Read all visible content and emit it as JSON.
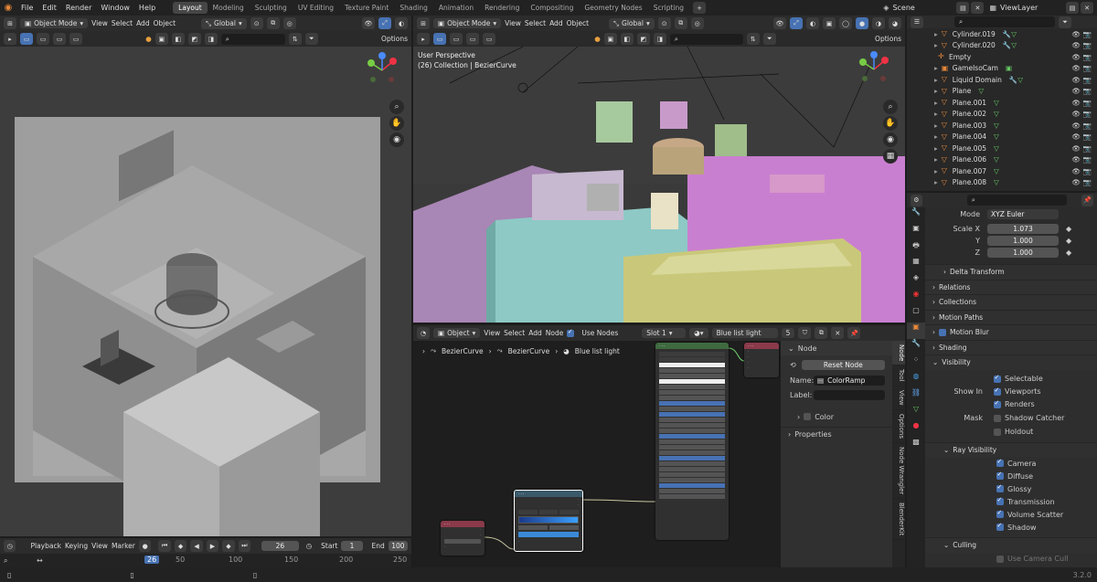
{
  "menu": [
    "File",
    "Edit",
    "Render",
    "Window",
    "Help"
  ],
  "workspaces": [
    "Layout",
    "Modeling",
    "Sculpting",
    "UV Editing",
    "Texture Paint",
    "Shading",
    "Animation",
    "Rendering",
    "Compositing",
    "Geometry Nodes",
    "Scripting"
  ],
  "active_workspace": "Layout",
  "scene_label": "Scene",
  "view_layer_label": "ViewLayer",
  "left_viewport": {
    "mode": "Object Mode",
    "view": "View",
    "select": "Select",
    "add": "Add",
    "object": "Object",
    "orientation": "Global",
    "options": "Options"
  },
  "right_viewport": {
    "mode": "Object Mode",
    "view": "View",
    "select": "Select",
    "add": "Add",
    "object": "Object",
    "orientation": "Global",
    "options": "Options",
    "perspective": "User Perspective",
    "collection": "(26) Collection | BezierCurve"
  },
  "outliner": [
    {
      "name": "Cylinder.019"
    },
    {
      "name": "Cylinder.020"
    },
    {
      "name": "Empty"
    },
    {
      "name": "GameIsoCam"
    },
    {
      "name": "Liquid Domain"
    },
    {
      "name": "Plane"
    },
    {
      "name": "Plane.001"
    },
    {
      "name": "Plane.002"
    },
    {
      "name": "Plane.003"
    },
    {
      "name": "Plane.004"
    },
    {
      "name": "Plane.005"
    },
    {
      "name": "Plane.006"
    },
    {
      "name": "Plane.007"
    },
    {
      "name": "Plane.008"
    }
  ],
  "properties": {
    "mode_label": "Mode",
    "mode_value": "XYZ Euler",
    "scale_x_label": "Scale X",
    "scale_x": "1.073",
    "scale_y_label": "Y",
    "scale_y": "1.000",
    "scale_z_label": "Z",
    "scale_z": "1.000",
    "sections": [
      "Delta Transform",
      "Relations",
      "Collections",
      "Motion Paths",
      "Motion Blur",
      "Shading"
    ],
    "visibility": "Visibility",
    "selectable": "Selectable",
    "show_in": "Show In",
    "viewports": "Viewports",
    "renders": "Renders",
    "mask": "Mask",
    "shadow_catcher": "Shadow Catcher",
    "holdout": "Holdout",
    "ray_visibility": "Ray Visibility",
    "rays": [
      "Camera",
      "Diffuse",
      "Glossy",
      "Transmission",
      "Volume Scatter",
      "Shadow"
    ],
    "culling": "Culling",
    "use_camera_cull": "Use Camera Cull"
  },
  "node_editor": {
    "type": "Object",
    "view": "View",
    "select": "Select",
    "add": "Add",
    "node": "Node",
    "use_nodes": "Use Nodes",
    "slot": "Slot 1",
    "material": "Blue list light",
    "users": "5",
    "breadcrumb": [
      "BezierCurve",
      "BezierCurve",
      "Blue list light"
    ]
  },
  "node_panel": {
    "title": "Node",
    "reset": "Reset Node",
    "name_label": "Name:",
    "name_value": "ColorRamp",
    "label_label": "Label:",
    "color": "Color",
    "properties": "Properties",
    "tabs": [
      "Node",
      "Tool",
      "View",
      "Options",
      "Node Wrangler",
      "BlenderKit"
    ]
  },
  "timeline": {
    "playback": "Playback",
    "keying": "Keying",
    "view": "View",
    "marker": "Marker",
    "current_frame": "26",
    "start_label": "Start",
    "start": "1",
    "end_label": "End",
    "end": "100",
    "ruler": [
      "26",
      "50",
      "100",
      "150",
      "200",
      "250"
    ]
  },
  "version": "3.2.0"
}
